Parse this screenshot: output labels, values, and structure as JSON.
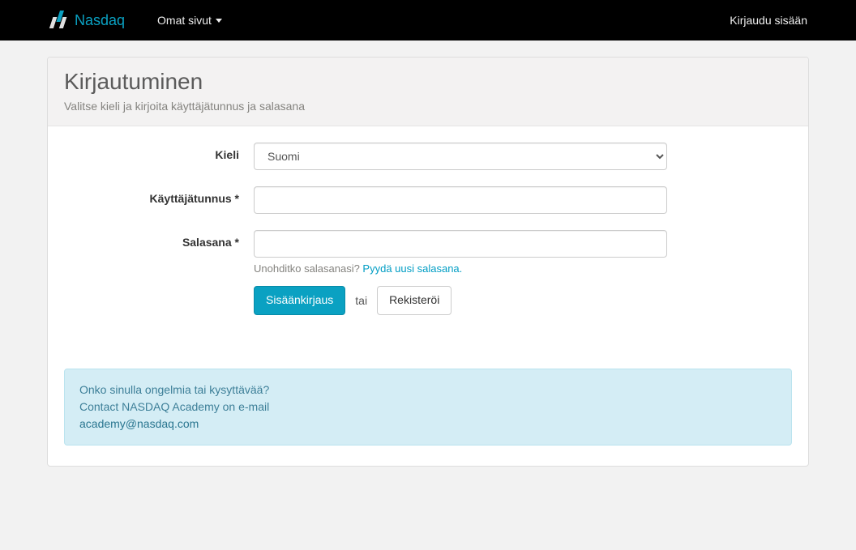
{
  "navbar": {
    "brand": "Nasdaq",
    "menu_label": "Omat sivut",
    "login": "Kirjaudu sisään"
  },
  "page": {
    "title": "Kirjautuminen",
    "subtitle": "Valitse kieli ja kirjoita käyttäjätunnus ja salasana"
  },
  "form": {
    "language_label": "Kieli",
    "language_value": "Suomi",
    "username_label": "Käyttäjätunnus *",
    "password_label": "Salasana *",
    "forgot_prefix": "Unohditko salasanasi? ",
    "forgot_link": "Pyydä uusi salasana.",
    "login_button": "Sisäänkirjaus",
    "or": "tai",
    "register_button": "Rekisteröi"
  },
  "alert": {
    "line1": "Onko sinulla ongelmia tai kysyttävää?",
    "line2": "Contact NASDAQ Academy on e-mail",
    "email": "academy@nasdaq.com"
  }
}
